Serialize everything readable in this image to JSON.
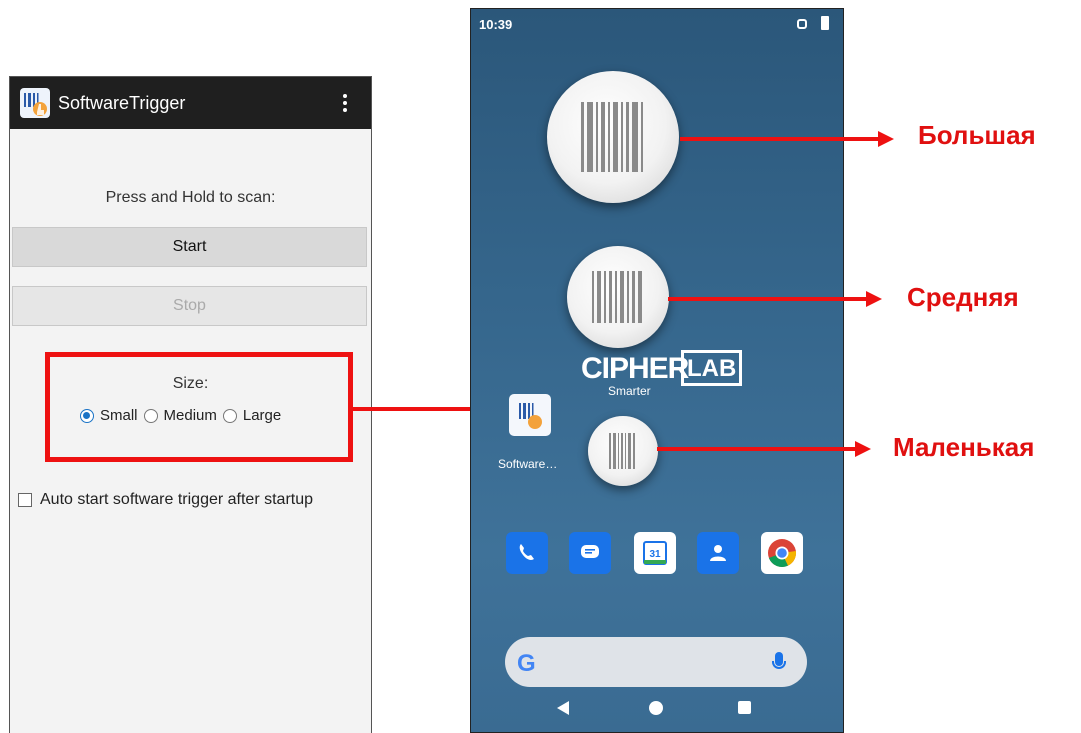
{
  "app": {
    "title": "SoftwareTrigger",
    "prompt": "Press and Hold to scan:",
    "start_label": "Start",
    "stop_label": "Stop",
    "size_label": "Size:",
    "size_options": [
      "Small",
      "Medium",
      "Large"
    ],
    "size_selected": "Small",
    "auto_start_label": "Auto start software trigger after startup",
    "auto_start_checked": false
  },
  "phone": {
    "time": "10:39",
    "logo_main": "CIPHER",
    "logo_box": "LAB",
    "logo_tagline": "Smarter",
    "shortcut_label": "Software…",
    "dock_icons": [
      "phone-icon",
      "messages-icon",
      "calendar-icon",
      "contacts-icon",
      "chrome-icon"
    ],
    "calendar_day": "31",
    "search_logo": "G"
  },
  "annotations": {
    "large": "Большая",
    "medium": "Средняя",
    "small": "Маленькая"
  },
  "colors": {
    "accent_red": "#ee1111",
    "radio_blue": "#1a73c6",
    "app_bar": "#1f1f1f"
  }
}
